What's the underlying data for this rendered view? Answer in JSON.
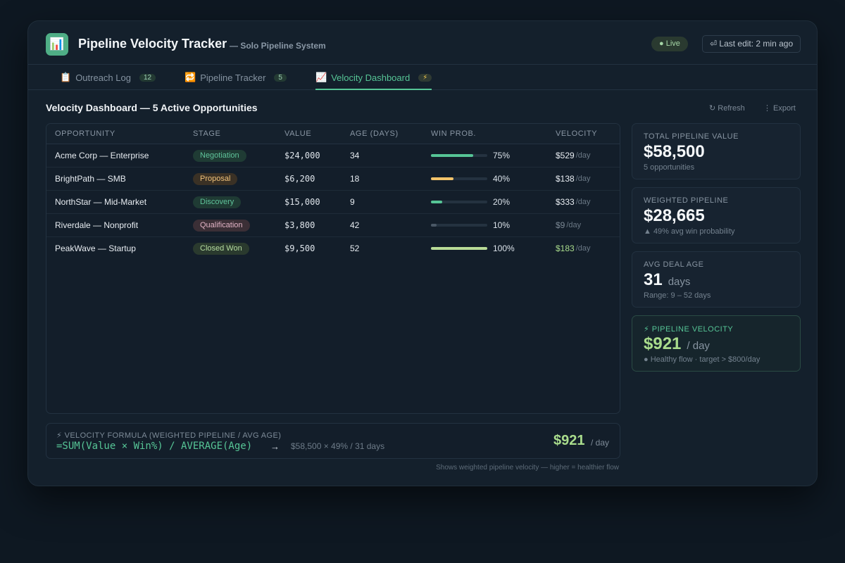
{
  "app": {
    "icon": "chart-icon",
    "title": "Pipeline Velocity Tracker",
    "subtitle": "— Solo Pipeline System",
    "live_label": "● Live",
    "last_edit": "⏎ Last edit: 2 min ago"
  },
  "tabs": [
    {
      "icon": "📋",
      "label": "Outreach Log",
      "badge": "12"
    },
    {
      "icon": "🔁",
      "label": "Pipeline Tracker",
      "badge": "5"
    },
    {
      "icon": "📈",
      "label": "Velocity Dashboard",
      "badge": "⚡"
    }
  ],
  "section": {
    "title": "Velocity Dashboard — 5 Active Opportunities",
    "refresh_label": "↻ Refresh",
    "export_label": "⋮ Export"
  },
  "table": {
    "columns": [
      "Opportunity",
      "Stage",
      "Value",
      "Age (Days)",
      "Win Prob.",
      "Velocity"
    ],
    "rows": [
      {
        "opportunity": "Acme Corp — Enterprise",
        "stage": "Negotiation",
        "value": "$24,000",
        "age": "34",
        "win_prob": 75,
        "win_label": "75%",
        "velocity": "$529",
        "velocity_unit": "/day"
      },
      {
        "opportunity": "BrightPath — SMB",
        "stage": "Proposal",
        "value": "$6,200",
        "age": "18",
        "win_prob": 40,
        "win_label": "40%",
        "velocity": "$138",
        "velocity_unit": "/day"
      },
      {
        "opportunity": "NorthStar — Mid-Market",
        "stage": "Discovery",
        "value": "$15,000",
        "age": "9",
        "win_prob": 20,
        "win_label": "20%",
        "velocity": "$333",
        "velocity_unit": "/day"
      },
      {
        "opportunity": "Riverdale — Nonprofit",
        "stage": "Qualification",
        "value": "$3,800",
        "age": "42",
        "win_prob": 10,
        "win_label": "10%",
        "velocity": "$9",
        "velocity_unit": "/day"
      },
      {
        "opportunity": "PeakWave — Startup",
        "stage": "Closed Won",
        "value": "$9,500",
        "age": "52",
        "win_prob": 100,
        "win_label": "100%",
        "velocity": "$183",
        "velocity_unit": "/day"
      }
    ]
  },
  "stage_colors": {
    "Negotiation": {
      "bg": "#1f3b34",
      "fg": "#5fc39a"
    },
    "Proposal": {
      "bg": "#3a3125",
      "fg": "#f0c27a"
    },
    "Discovery": {
      "bg": "#1f3b34",
      "fg": "#5fc39a"
    },
    "Qualification": {
      "bg": "#3b2f36",
      "fg": "#e3b4c6"
    },
    "Closed Won": {
      "bg": "#2a3a2e",
      "fg": "#b5dca0"
    }
  },
  "bar_colors": [
    "#56c596",
    "#f3c46a",
    "#56c596",
    "#4a5866",
    "#b9dc97"
  ],
  "velocity_colors": [
    "#e8edf2",
    "#e8edf2",
    "#e8edf2",
    "#7b8894",
    "#a9dc8c"
  ],
  "formula": {
    "label": "⚡ Velocity Formula (Weighted Pipeline / Avg Age)",
    "code": "=SUM(Value × Win%) / AVERAGE(Age)",
    "arrow": "→",
    "calc": "$58,500 × 49% / 31 days",
    "value": "$921",
    "unit": "/ day"
  },
  "footnote": "Shows weighted pipeline velocity — higher = healthier flow",
  "cards": [
    {
      "label": "Total Pipeline Value",
      "value": "$58,500",
      "unit": "",
      "sub": "5 opportunities"
    },
    {
      "label": "Weighted Pipeline",
      "value": "$28,665",
      "unit": "",
      "sub": "▲ 49% avg win probability"
    },
    {
      "label": "Avg Deal Age",
      "value": "31",
      "unit": "days",
      "sub": "Range: 9 – 52 days"
    },
    {
      "label": "⚡ Pipeline Velocity",
      "value": "$921",
      "unit": "/ day",
      "sub": "● Healthy flow · target > $800/day"
    }
  ]
}
